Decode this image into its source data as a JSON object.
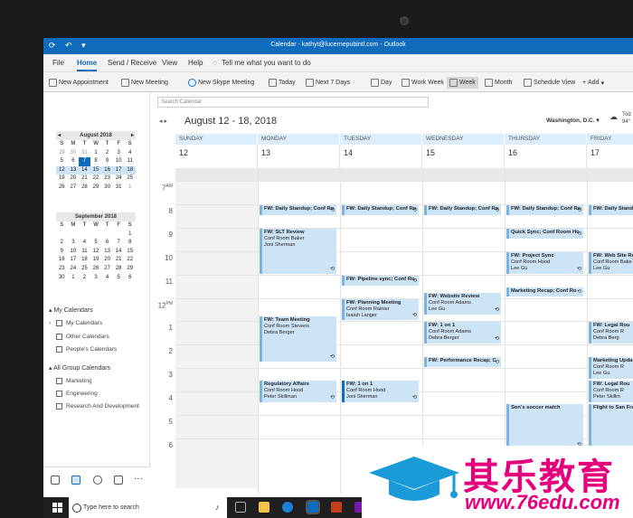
{
  "window": {
    "title": "Calendar - kathyt@lucernepubintl.com - Outlook"
  },
  "menu": [
    "File",
    "Home",
    "Send / Receive",
    "View",
    "Help"
  ],
  "tell_me": "Tell me what you want to do",
  "ribbon": {
    "new_appointment": "New Appointment",
    "new_meeting": "New Meeting",
    "new_skype": "New Skype Meeting",
    "today": "Today",
    "next7": "Next 7 Days",
    "day": "Day",
    "work_week": "Work Week",
    "week": "Week",
    "month": "Month",
    "schedule": "Schedule View",
    "add": "Add"
  },
  "mini_cal_1": {
    "title": "August 2018",
    "headers": [
      "S",
      "M",
      "T",
      "W",
      "T",
      "F",
      "S"
    ],
    "rows": [
      [
        "29",
        "30",
        "31",
        "1",
        "2",
        "3",
        "4"
      ],
      [
        "5",
        "6",
        "7",
        "8",
        "9",
        "10",
        "11"
      ],
      [
        "12",
        "13",
        "14",
        "15",
        "16",
        "17",
        "18"
      ],
      [
        "19",
        "20",
        "21",
        "22",
        "23",
        "24",
        "25"
      ],
      [
        "26",
        "27",
        "28",
        "29",
        "30",
        "31",
        "1"
      ]
    ]
  },
  "mini_cal_2": {
    "title": "September 2018",
    "headers": [
      "S",
      "M",
      "T",
      "W",
      "T",
      "F",
      "S"
    ],
    "rows": [
      [
        "",
        "",
        "",
        "",
        "",
        "",
        "1"
      ],
      [
        "2",
        "3",
        "4",
        "5",
        "6",
        "7",
        "8"
      ],
      [
        "9",
        "10",
        "11",
        "12",
        "13",
        "14",
        "15"
      ],
      [
        "16",
        "17",
        "18",
        "19",
        "20",
        "21",
        "22"
      ],
      [
        "23",
        "24",
        "25",
        "26",
        "27",
        "28",
        "29"
      ],
      [
        "30",
        "1",
        "2",
        "3",
        "4",
        "5",
        "6"
      ]
    ]
  },
  "sidebar": {
    "my_calendars_header": "My Calendars",
    "my_calendars": [
      "My Calendars",
      "Other Calendars",
      "People's Calendars"
    ],
    "group_header": "All Group Calendars",
    "groups": [
      "Marketing",
      "Engineering",
      "Research And Development"
    ]
  },
  "calendar": {
    "search_placeholder": "Search Calendar",
    "range": "August 12 - 18, 2018",
    "location": "Washington, D.C.",
    "weather_label": "Tod",
    "weather_temp": "94°",
    "days": [
      {
        "name": "SUNDAY",
        "num": "12"
      },
      {
        "name": "MONDAY",
        "num": "13"
      },
      {
        "name": "TUESDAY",
        "num": "14"
      },
      {
        "name": "WEDNESDAY",
        "num": "15"
      },
      {
        "name": "THURSDAY",
        "num": "16"
      },
      {
        "name": "FRIDAY",
        "num": "17"
      }
    ],
    "hours": [
      "7",
      "8",
      "9",
      "10",
      "11",
      "12",
      "1",
      "2",
      "3",
      "4",
      "5",
      "6"
    ],
    "am": "AM",
    "pm": "PM"
  },
  "events": [
    {
      "title": "FW: Daily Standup; Conf Ro",
      "l1": "",
      "l2": ""
    },
    {
      "title": "FW: Daily Standup; Conf Ro",
      "l1": "",
      "l2": ""
    },
    {
      "title": "FW: Daily Standup; Conf Ro",
      "l1": "",
      "l2": ""
    },
    {
      "title": "FW: Daily Standup; Conf Ro",
      "l1": "",
      "l2": ""
    },
    {
      "title": "FW: Daily Standup; Conf Ro",
      "l1": "",
      "l2": ""
    },
    {
      "title": "FW: SLT Review",
      "l1": "Conf Room Baker",
      "l2": "Joni Sherman"
    },
    {
      "title": "Quick Sync; Conf Room Ho",
      "l1": "",
      "l2": ""
    },
    {
      "title": "FW: Project Sync",
      "l1": "Conf Room Hood",
      "l2": "Lee Gu"
    },
    {
      "title": "FW: Web Site Re",
      "l1": "Conf Room Bake",
      "l2": "Lee Gu"
    },
    {
      "title": "FW: Pipeline sync; Conf Ro",
      "l1": "",
      "l2": ""
    },
    {
      "title": "FW: Website Review",
      "l1": "Conf Room Adams",
      "l2": "Lee Gu"
    },
    {
      "title": "Marketing Recap; Conf Ro",
      "l1": "",
      "l2": ""
    },
    {
      "title": "FW: Planning Meeting",
      "l1": "Conf Room Rainier",
      "l2": "Isaiah Langer"
    },
    {
      "title": "FW: Team Meeting",
      "l1": "Conf Room Stevens",
      "l2": "Debra Berger"
    },
    {
      "title": "FW: 1 on 1",
      "l1": "Conf Room Adams",
      "l2": "Debra Berger"
    },
    {
      "title": "FW: Legal Rou",
      "l1": "Conf Room R",
      "l2": "Debra Berg"
    },
    {
      "title": "FW: Performance Recap; C",
      "l1": "",
      "l2": ""
    },
    {
      "title": "Marketing Upda",
      "l1": "Conf Room R",
      "l2": "Lee Gu"
    },
    {
      "title": "Regulatory Affairs",
      "l1": "Conf Room Hood",
      "l2": "Peter Skillman"
    },
    {
      "title": "FW: 1 on 1",
      "l1": "Conf Room Hood",
      "l2": "Joni Sherman"
    },
    {
      "title": "FW: Legal Rou",
      "l1": "Conf Room R",
      "l2": "Peter Skillm"
    },
    {
      "title": "Son's soccer match",
      "l1": "",
      "l2": ""
    },
    {
      "title": "Flight to San Fra",
      "l1": "",
      "l2": ""
    }
  ],
  "taskbar": {
    "search": "Type here to search"
  },
  "watermark": {
    "cn": "其乐教育",
    "url": "www.76edu.com"
  }
}
